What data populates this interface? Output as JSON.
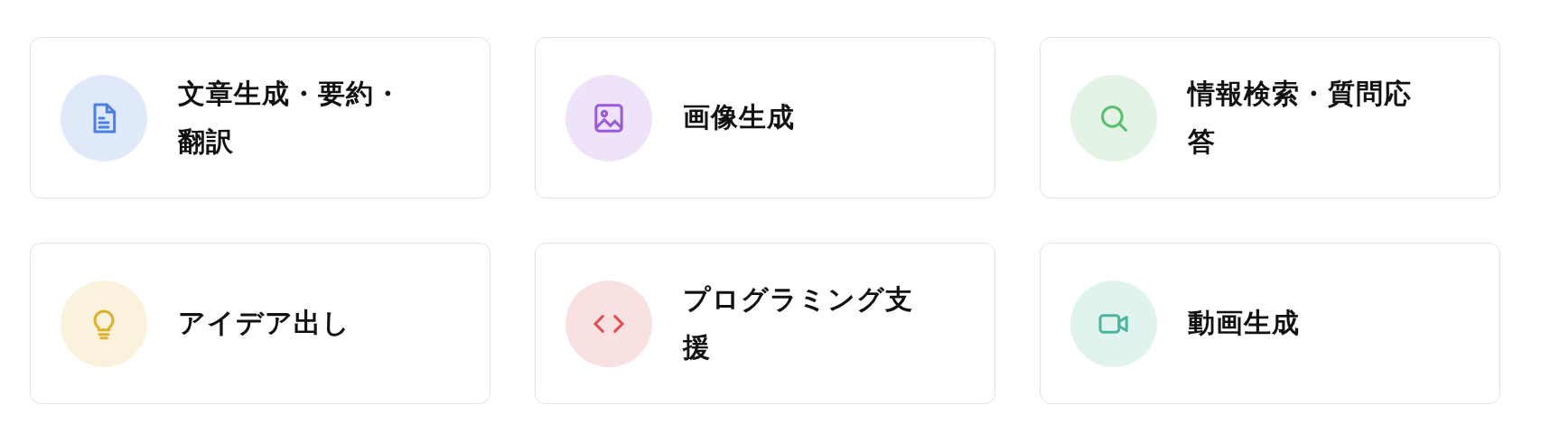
{
  "cards": [
    {
      "kind": "document",
      "color": "#4a7fe3",
      "label": "文章生成・要約・翻訳"
    },
    {
      "kind": "image",
      "color": "#9b59de",
      "label": "画像生成"
    },
    {
      "kind": "search",
      "color": "#5bbf6e",
      "label": "情報検索・質問応答"
    },
    {
      "kind": "idea",
      "color": "#e0b12f",
      "label": "アイデア出し"
    },
    {
      "kind": "code",
      "color": "#df4f4f",
      "label": "プログラミング支援"
    },
    {
      "kind": "video",
      "color": "#4bb69e",
      "label": "動画生成"
    }
  ]
}
